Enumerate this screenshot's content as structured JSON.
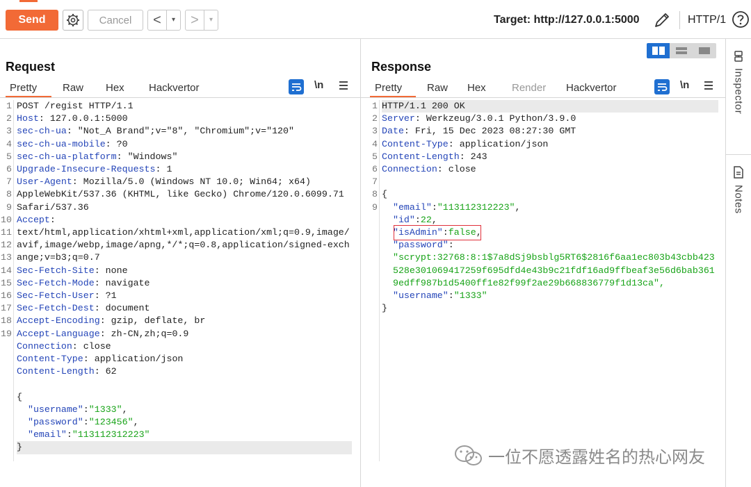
{
  "toolbar": {
    "send_label": "Send",
    "cancel_label": "Cancel",
    "back_arrow": "<",
    "forward_arrow": ">",
    "dropdown": "▾",
    "target_label": "Target: http://127.0.0.1:5000",
    "http_version": "HTTP/1"
  },
  "request": {
    "title": "Request",
    "tabs": [
      "Pretty",
      "Raw",
      "Hex",
      "Hackvertor"
    ],
    "newline_toggle": "\\n",
    "line_numbers": [
      "1",
      "2",
      "3",
      "4",
      "5",
      "6",
      "7",
      "",
      "",
      "8",
      "",
      "",
      "",
      "9",
      "10",
      "11",
      "12",
      "13",
      "14",
      "15",
      "16",
      "17",
      "18",
      "19",
      "",
      "",
      "",
      ""
    ],
    "headers": [
      {
        "n": "1",
        "text": "POST /regist HTTP/1.1"
      },
      {
        "n": "2",
        "key": "Host",
        "val": " 127.0.0.1:5000"
      },
      {
        "n": "3",
        "key": "sec-ch-ua",
        "val": " \"Not_A Brand\";v=\"8\", \"Chromium\";v=\"120\""
      },
      {
        "n": "4",
        "key": "sec-ch-ua-mobile",
        "val": " ?0"
      },
      {
        "n": "5",
        "key": "sec-ch-ua-platform",
        "val": " \"Windows\""
      },
      {
        "n": "6",
        "key": "Upgrade-Insecure-Requests",
        "val": " 1"
      },
      {
        "n": "7",
        "key": "User-Agent",
        "val": " Mozilla/5.0 (Windows NT 10.0; Win64; x64)"
      },
      {
        "n": "",
        "text": "AppleWebKit/537.36 (KHTML, like Gecko) Chrome/120.0.6099.71"
      },
      {
        "n": "",
        "text": "Safari/537.36"
      },
      {
        "n": "8",
        "key": "Accept",
        "val": ""
      },
      {
        "n": "",
        "text": "text/html,application/xhtml+xml,application/xml;q=0.9,image/"
      },
      {
        "n": "",
        "text": "avif,image/webp,image/apng,*/*;q=0.8,application/signed-exch"
      },
      {
        "n": "",
        "text": "ange;v=b3;q=0.7"
      },
      {
        "n": "9",
        "key": "Sec-Fetch-Site",
        "val": " none"
      },
      {
        "n": "10",
        "key": "Sec-Fetch-Mode",
        "val": " navigate"
      },
      {
        "n": "11",
        "key": "Sec-Fetch-User",
        "val": " ?1"
      },
      {
        "n": "12",
        "key": "Sec-Fetch-Dest",
        "val": " document"
      },
      {
        "n": "13",
        "key": "Accept-Encoding",
        "val": " gzip, deflate, br"
      },
      {
        "n": "14",
        "key": "Accept-Language",
        "val": " zh-CN,zh;q=0.9"
      },
      {
        "n": "15",
        "key": "Connection",
        "val": " close"
      },
      {
        "n": "16",
        "key": "Content-Type",
        "val": " application/json"
      },
      {
        "n": "17",
        "key": "Content-Length",
        "val": " 62"
      },
      {
        "n": "18",
        "text": ""
      },
      {
        "n": "19",
        "text": "{"
      },
      {
        "n": "",
        "jk": "username",
        "jv": "1333",
        "tail": ","
      },
      {
        "n": "",
        "jk": "password",
        "jv": "123456",
        "tail": ","
      },
      {
        "n": "",
        "jk": "email",
        "jv": "113112312223",
        "tail": ""
      },
      {
        "n": "",
        "text": "}",
        "hl": true
      }
    ]
  },
  "response": {
    "title": "Response",
    "tabs": [
      "Pretty",
      "Raw",
      "Hex",
      "Render",
      "Hackvertor"
    ],
    "newline_toggle": "\\n",
    "lines": [
      {
        "n": "1",
        "text": "HTTP/1.1 200 OK",
        "hl": true
      },
      {
        "n": "2",
        "key": "Server",
        "val": " Werkzeug/3.0.1 Python/3.9.0"
      },
      {
        "n": "3",
        "key": "Date",
        "val": " Fri, 15 Dec 2023 08:27:30 GMT"
      },
      {
        "n": "4",
        "key": "Content-Type",
        "val": " application/json"
      },
      {
        "n": "5",
        "key": "Content-Length",
        "val": " 243"
      },
      {
        "n": "6",
        "key": "Connection",
        "val": " close"
      },
      {
        "n": "7",
        "text": ""
      },
      {
        "n": "8",
        "text": "{"
      },
      {
        "n": "",
        "jk": "email",
        "jv": "113112312223",
        "tail": ","
      },
      {
        "n": "",
        "jk": "id",
        "raw": "22",
        "tail": ","
      },
      {
        "n": "",
        "jk": "isAdmin",
        "raw": "false",
        "tail": ","
      },
      {
        "n": "",
        "jk": "password",
        "raw": "",
        "tail": ""
      },
      {
        "n": "",
        "text2": "\"scrypt:32768:8:1$7a8dSj9bsblg5RT6$2816f6aa1ec803b43cbb423"
      },
      {
        "n": "",
        "text2": "528e301069417259f695dfd4e43b9c21fdf16ad9ffbeaf3e56d6bab361"
      },
      {
        "n": "",
        "text2": "9edff987b1d5400ff1e82f99f2ae29b668836779f1d13ca\","
      },
      {
        "n": "",
        "jk": "username",
        "jv": "1333",
        "tail": ""
      },
      {
        "n": "",
        "text": "}"
      },
      {
        "n": "9",
        "text": ""
      }
    ]
  },
  "inspector": {
    "inspector_label": "Inspector",
    "notes_label": "Notes"
  },
  "watermark": {
    "text": "一位不愿透露姓名的热心网友"
  },
  "colors": {
    "accent": "#f26a36",
    "key_blue": "#2445b8",
    "string_green": "#17a317",
    "highlight_red": "#e0303a",
    "toggle_blue": "#1f6fd1"
  }
}
